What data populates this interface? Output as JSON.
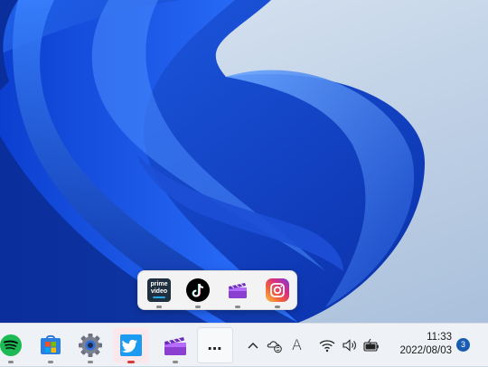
{
  "desktop": {
    "wallpaper": "Windows 11 Bloom (blue)"
  },
  "flyout_group": {
    "apps": [
      {
        "name": "Prime Video",
        "icon": "prime-video-icon",
        "label_line1": "prime",
        "label_line2": "video"
      },
      {
        "name": "TikTok",
        "icon": "tiktok-icon"
      },
      {
        "name": "Clipchamp",
        "icon": "clipchamp-icon"
      },
      {
        "name": "Instagram",
        "icon": "instagram-icon"
      }
    ]
  },
  "taskbar": {
    "apps": [
      {
        "name": "Spotify",
        "icon": "spotify-icon",
        "running": true
      },
      {
        "name": "Microsoft Store",
        "icon": "store-icon",
        "running": true
      },
      {
        "name": "Settings",
        "icon": "settings-gear-icon",
        "running": true
      },
      {
        "name": "Twitter",
        "icon": "twitter-icon",
        "running": true,
        "active": true
      },
      {
        "name": "Clipchamp",
        "icon": "clipchamp-icon",
        "running": true
      },
      {
        "name": "More",
        "icon": "ellipsis-icon",
        "label": "…"
      }
    ],
    "tray": {
      "chevron": "chevron-up-icon",
      "sync": "onedrive-sync-icon",
      "input": "A",
      "wifi": "wifi-icon",
      "volume": "volume-icon",
      "battery": "battery-icon"
    },
    "clock": {
      "time": "11:33",
      "date": "2022/08/03"
    },
    "notification_count": "3"
  },
  "colors": {
    "accent": "#1a5cb0",
    "active_indicator": "#d83a3a",
    "taskbar_bg": "#eef1f5"
  }
}
